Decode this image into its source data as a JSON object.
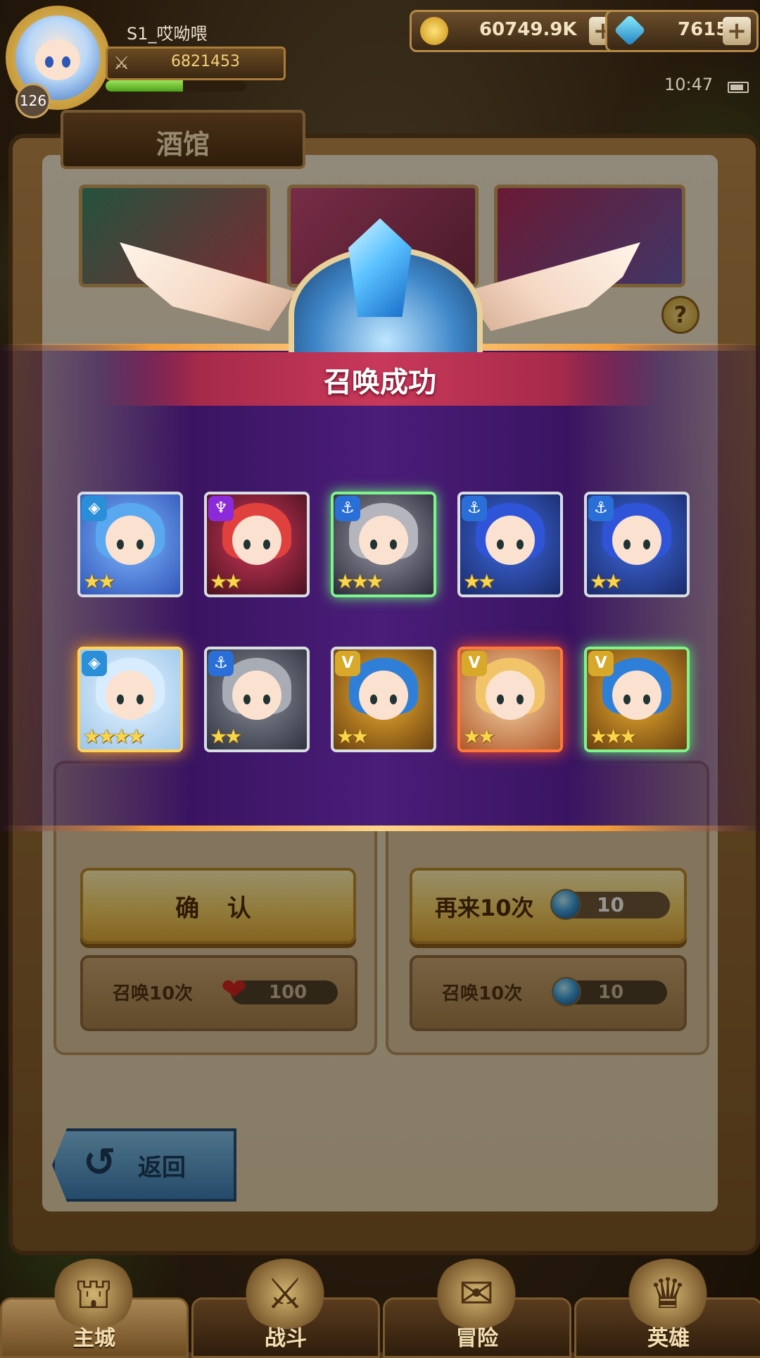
{
  "player": {
    "name": "S1_哎呦喂",
    "level": "126",
    "power": "6821453",
    "exp_fraction": 0.55
  },
  "currency": {
    "gold": "60749.9K",
    "gems": "7615"
  },
  "status": {
    "time": "10:47"
  },
  "tavern": {
    "title": "酒馆",
    "help": "?"
  },
  "overlay": {
    "title": "召唤成功",
    "heroes_row1": [
      {
        "class_icon": "◈",
        "class_color": "#2a8fd8",
        "stars": "★★",
        "frame": "silver",
        "palette": [
          "#7fb8ff",
          "#3256b8"
        ],
        "hair": "#5aa8f0"
      },
      {
        "class_icon": "♆",
        "class_color": "#8a2ad8",
        "stars": "★★",
        "frame": "silver",
        "palette": [
          "#d03a5a",
          "#4a1020"
        ],
        "hair": "#e0403e"
      },
      {
        "class_icon": "⚓",
        "class_color": "#2a6fd8",
        "stars": "★★★",
        "frame": "green",
        "palette": [
          "#9a9aa8",
          "#2b2b3a"
        ],
        "hair": "#b5b5bd"
      },
      {
        "class_icon": "⚓",
        "class_color": "#2a6fd8",
        "stars": "★★",
        "frame": "silver",
        "palette": [
          "#3e6be0",
          "#1a2a6a"
        ],
        "hair": "#2f54d8"
      },
      {
        "class_icon": "⚓",
        "class_color": "#2a6fd8",
        "stars": "★★",
        "frame": "silver",
        "palette": [
          "#3e6be0",
          "#1a2a6a"
        ],
        "hair": "#2f54d8"
      }
    ],
    "heroes_row2": [
      {
        "class_icon": "◈",
        "class_color": "#2a8fd8",
        "stars": "★★★★",
        "frame": "gold",
        "palette": [
          "#e8f4ff",
          "#9cc6ea"
        ],
        "hair": "#d8ecff"
      },
      {
        "class_icon": "⚓",
        "class_color": "#2a6fd8",
        "stars": "★★",
        "frame": "silver",
        "palette": [
          "#8a8e98",
          "#2f3340"
        ],
        "hair": "#a8acb5"
      },
      {
        "class_icon": "V",
        "class_color": "#d8a82a",
        "stars": "★★",
        "frame": "silver",
        "palette": [
          "#f0b030",
          "#6a4010"
        ],
        "hair": "#2f7fd8"
      },
      {
        "class_icon": "V",
        "class_color": "#d8a82a",
        "stars": "★★",
        "frame": "red",
        "palette": [
          "#f6d6a8",
          "#b0582a"
        ],
        "hair": "#f2c46a"
      },
      {
        "class_icon": "V",
        "class_color": "#d8a82a",
        "stars": "★★★",
        "frame": "green",
        "palette": [
          "#f0b030",
          "#6a4010"
        ],
        "hair": "#2f7fd8"
      }
    ]
  },
  "buttons": {
    "confirm": "确 认",
    "again": "再来10次",
    "again_cost": "10",
    "back": "返回"
  },
  "summon": {
    "left_label": "召唤10次",
    "left_cost": "100",
    "right_label": "召唤10次",
    "right_cost": "10"
  },
  "nav": [
    "主城",
    "战斗",
    "冒险",
    "英雄"
  ]
}
